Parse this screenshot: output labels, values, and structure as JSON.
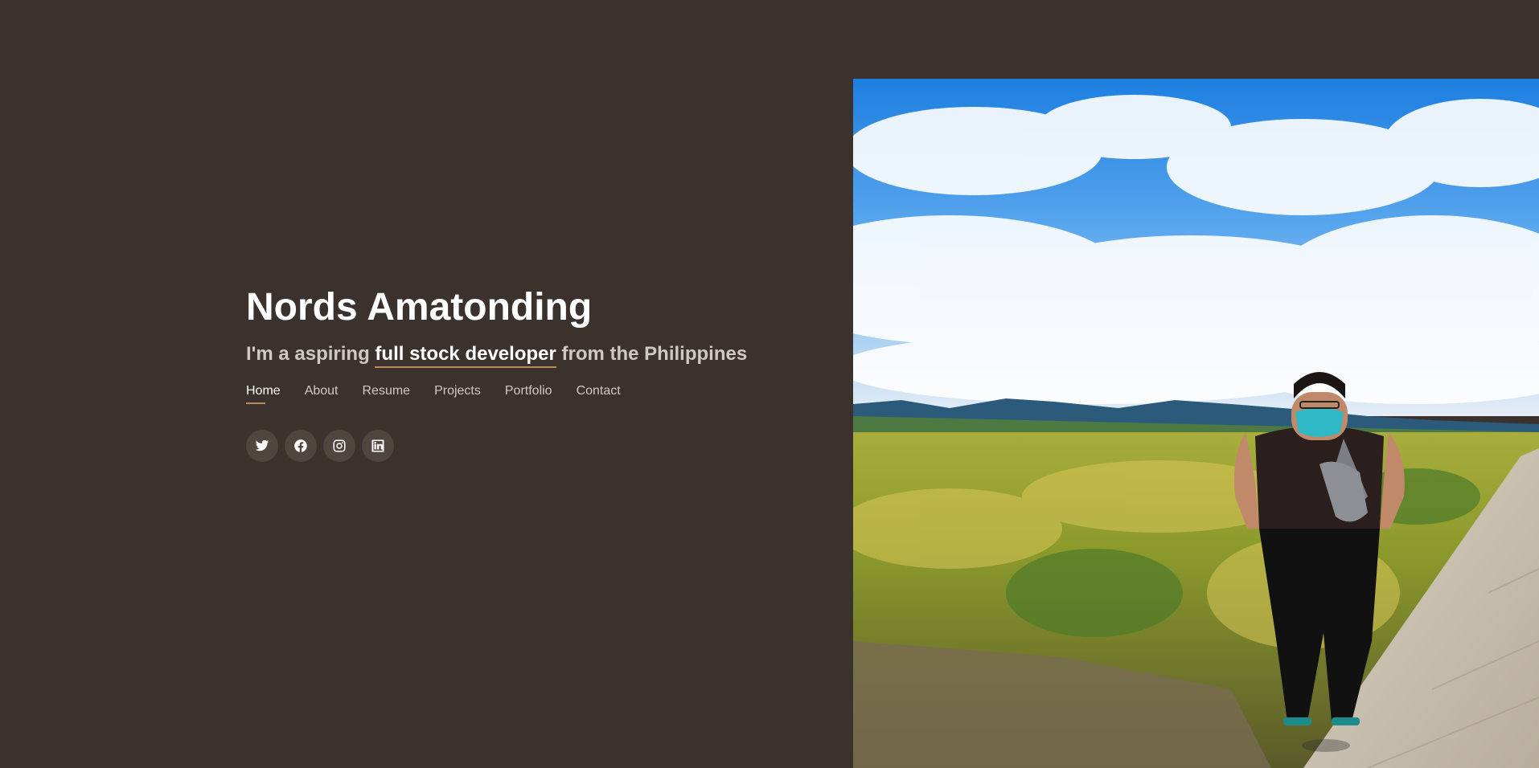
{
  "hero": {
    "name": "Nords Amatonding",
    "tagline_prefix": "I'm a aspiring ",
    "tagline_highlight": "full stock developer",
    "tagline_suffix": " from the Philippines"
  },
  "nav": {
    "items": [
      {
        "label": "Home",
        "active": true
      },
      {
        "label": "About",
        "active": false
      },
      {
        "label": "Resume",
        "active": false
      },
      {
        "label": "Projects",
        "active": false
      },
      {
        "label": "Portfolio",
        "active": false
      },
      {
        "label": "Contact",
        "active": false
      }
    ]
  },
  "social": {
    "icons": [
      "twitter-icon",
      "facebook-icon",
      "instagram-icon",
      "linkedin-icon"
    ]
  },
  "colors": {
    "background": "#3b322d",
    "accent": "#b58d5e",
    "text": "#ffffff",
    "muted_text": "#cfc9c4",
    "icon_circle": "#504640"
  }
}
